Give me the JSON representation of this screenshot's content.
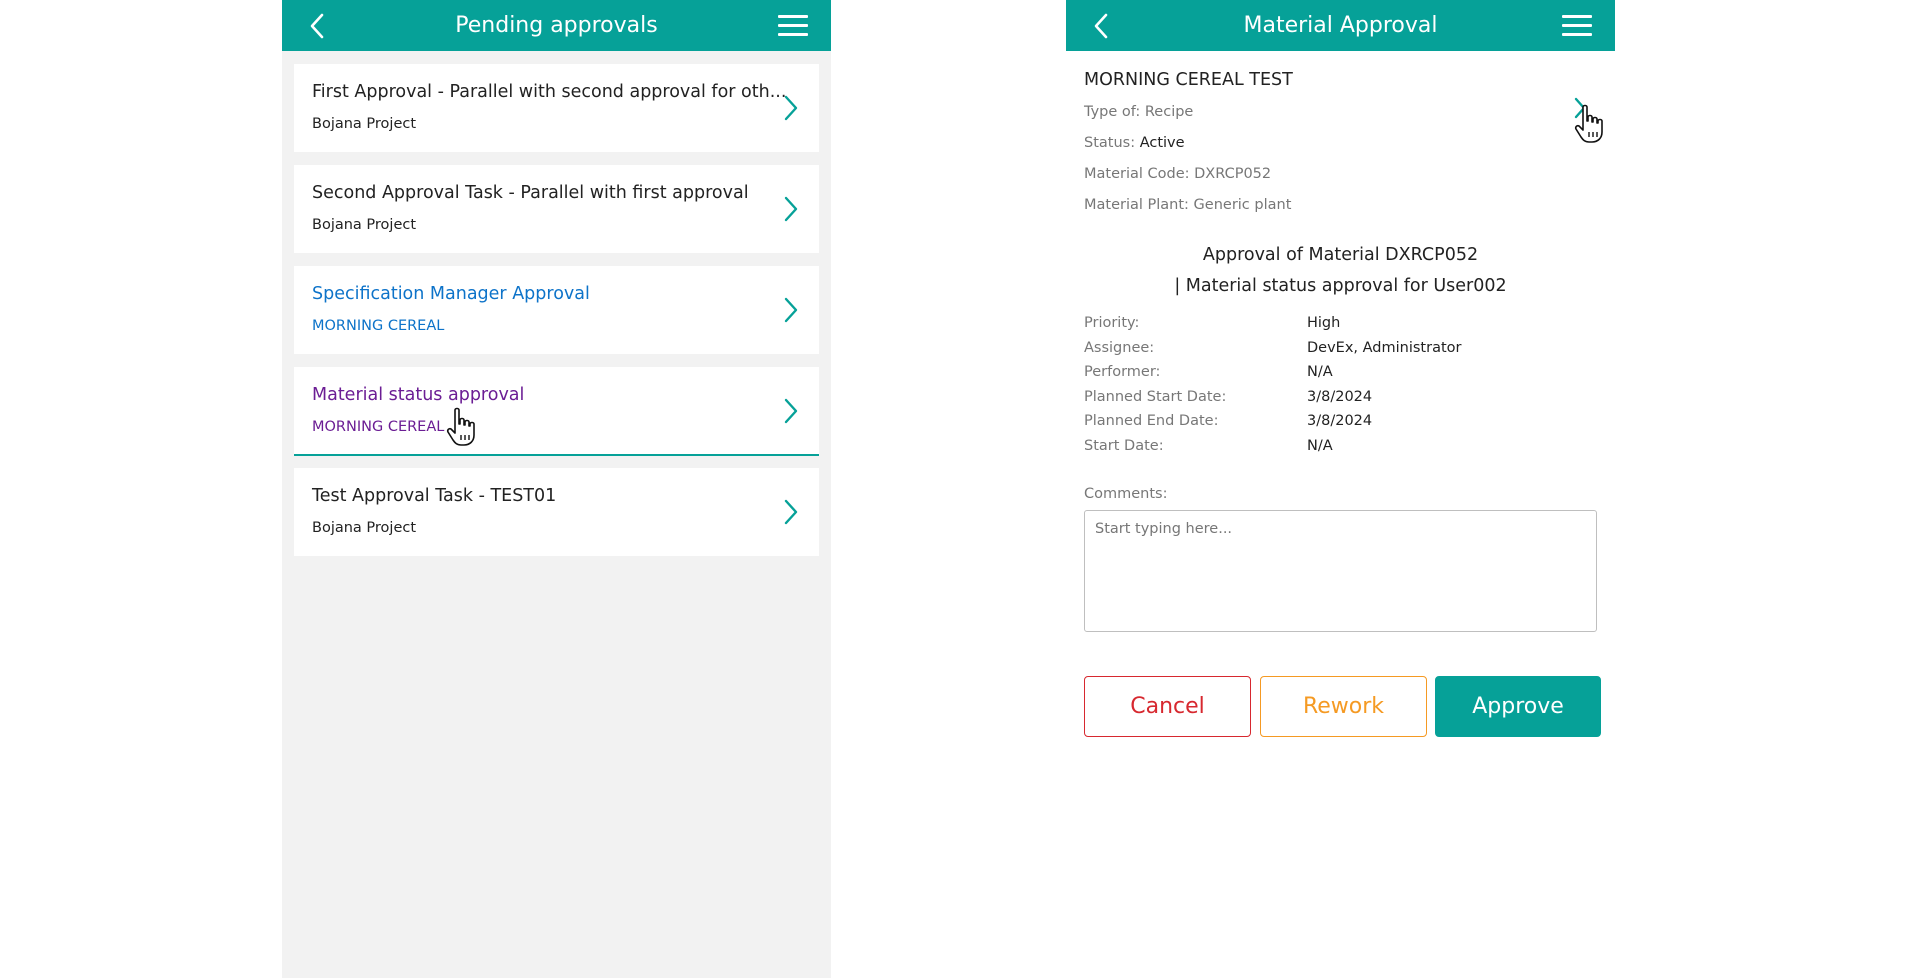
{
  "left": {
    "header": {
      "title": "Pending approvals"
    },
    "items": [
      {
        "title": "First Approval - Parallel with second approval for oth...",
        "subtitle": "Bojana Project"
      },
      {
        "title": "Second Approval Task - Parallel with first approval",
        "subtitle": "Bojana Project"
      },
      {
        "title": "Specification Manager Approval",
        "subtitle": "MORNING CEREAL"
      },
      {
        "title": "Material status approval",
        "subtitle": "MORNING CEREAL"
      },
      {
        "title": "Test Approval Task - TEST01",
        "subtitle": "Bojana Project"
      }
    ]
  },
  "right": {
    "header": {
      "title": "Material Approval"
    },
    "material": {
      "name": "MORNING CEREAL TEST",
      "type_label": "Type of:",
      "type_value": "Recipe",
      "status_label": "Status:",
      "status_value": "Active",
      "code_label": "Material Code:",
      "code_value": "DXRCP052",
      "plant_label": "Material Plant:",
      "plant_value": "Generic plant"
    },
    "approval_title_line1": "Approval of Material DXRCP052",
    "approval_title_line2": "| Material status approval for User002",
    "details": [
      {
        "label": "Priority:",
        "value": "High"
      },
      {
        "label": "Assignee:",
        "value": "DevEx, Administrator"
      },
      {
        "label": "Performer:",
        "value": "N/A"
      },
      {
        "label": "Planned Start Date:",
        "value": "3/8/2024"
      },
      {
        "label": "Planned End Date:",
        "value": "3/8/2024"
      },
      {
        "label": "Start Date:",
        "value": "N/A"
      }
    ],
    "comments": {
      "label": "Comments:",
      "placeholder": "Start typing here...",
      "value": ""
    },
    "buttons": {
      "cancel": "Cancel",
      "rework": "Rework",
      "approve": "Approve"
    }
  },
  "colors": {
    "accent": "#06a198",
    "link_blue": "#0d73c9",
    "visited_purple": "#6b1d94",
    "cancel_red": "#d7282f",
    "rework_orange": "#f59a23"
  },
  "icons": [
    "back-arrow-icon",
    "hamburger-menu-icon",
    "chevron-right-icon",
    "hand-pointer-cursor-icon"
  ]
}
